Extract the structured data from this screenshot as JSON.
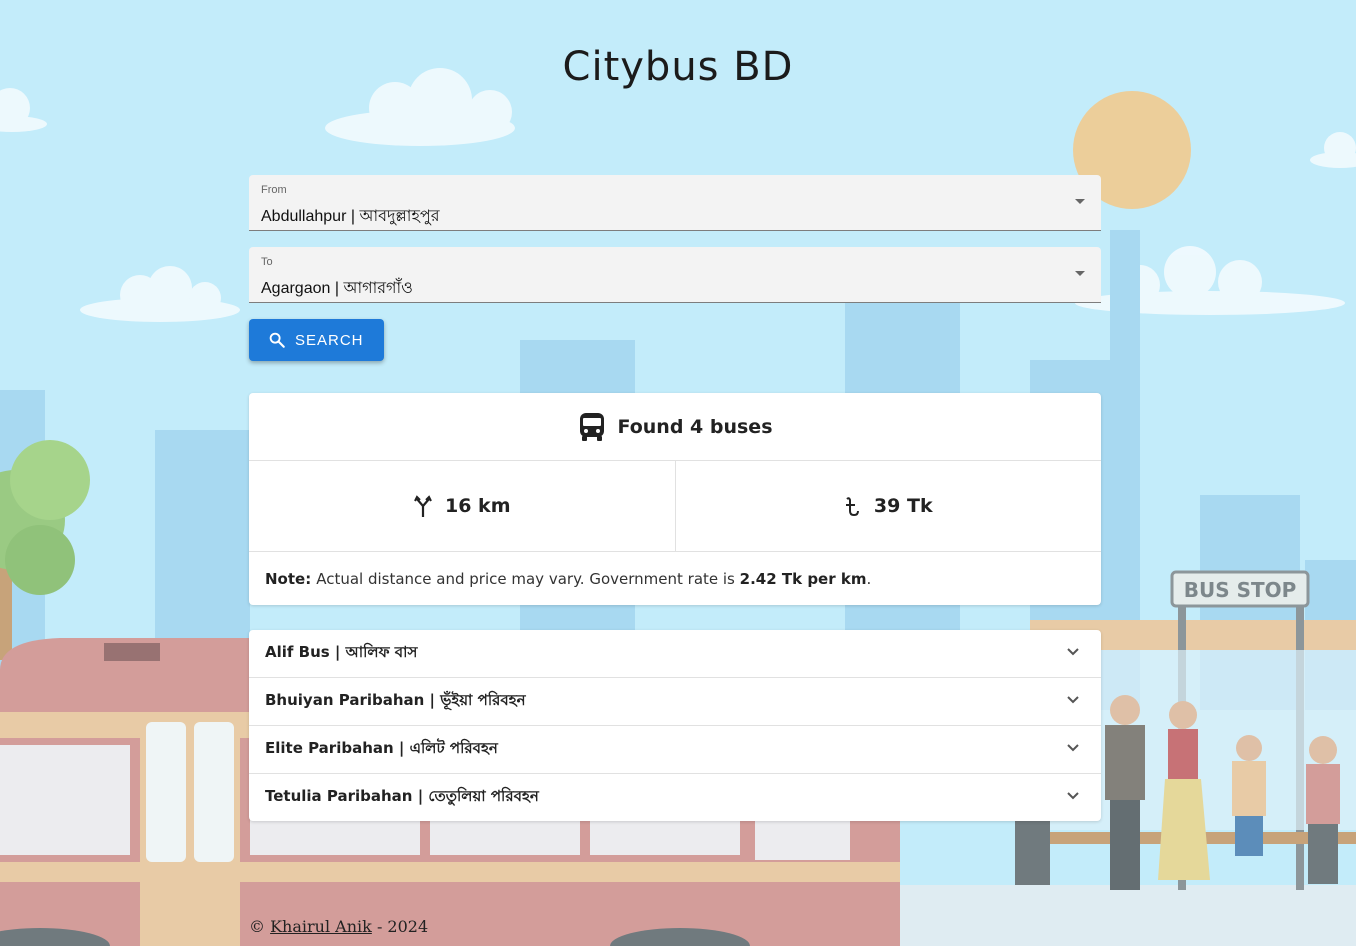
{
  "app": {
    "title": "Citybus BD"
  },
  "search": {
    "from_label": "From",
    "from_value": "Abdullahpur | আবদুল্লাহপুর",
    "to_label": "To",
    "to_value": "Agargaon | আগারগাঁও",
    "button_label": "SEARCH"
  },
  "results": {
    "found_text": "Found 4 buses",
    "distance": "16 km",
    "price": "39 Tk",
    "note_prefix": "Note:",
    "note_text": "Actual distance and price may vary. Government rate is",
    "note_rate": "2.42 Tk per km",
    "note_end": "."
  },
  "buses": [
    {
      "name": "Alif Bus | আলিফ বাস"
    },
    {
      "name": "Bhuiyan Paribahan | ভূঁইয়া পরিবহন"
    },
    {
      "name": "Elite Paribahan | এলিট পরিবহন"
    },
    {
      "name": "Tetulia Paribahan | তেতুলিয়া পরিবহন"
    }
  ],
  "footer": {
    "copyright": "©",
    "author": "Khairul Anik",
    "year": "- 2024"
  },
  "background": {
    "bus_stop_sign": "BUS STOP"
  },
  "colors": {
    "sky": "#c3ecfa",
    "sun": "#fac57a",
    "accent": "#1e7ad9",
    "bus_body": "#d9837a"
  },
  "icons": {
    "search": "search-icon",
    "bus": "bus-icon",
    "distance": "route-fork-icon",
    "currency": "taka-icon",
    "expand": "chevron-down-icon",
    "dropdown": "caret-down-icon"
  }
}
